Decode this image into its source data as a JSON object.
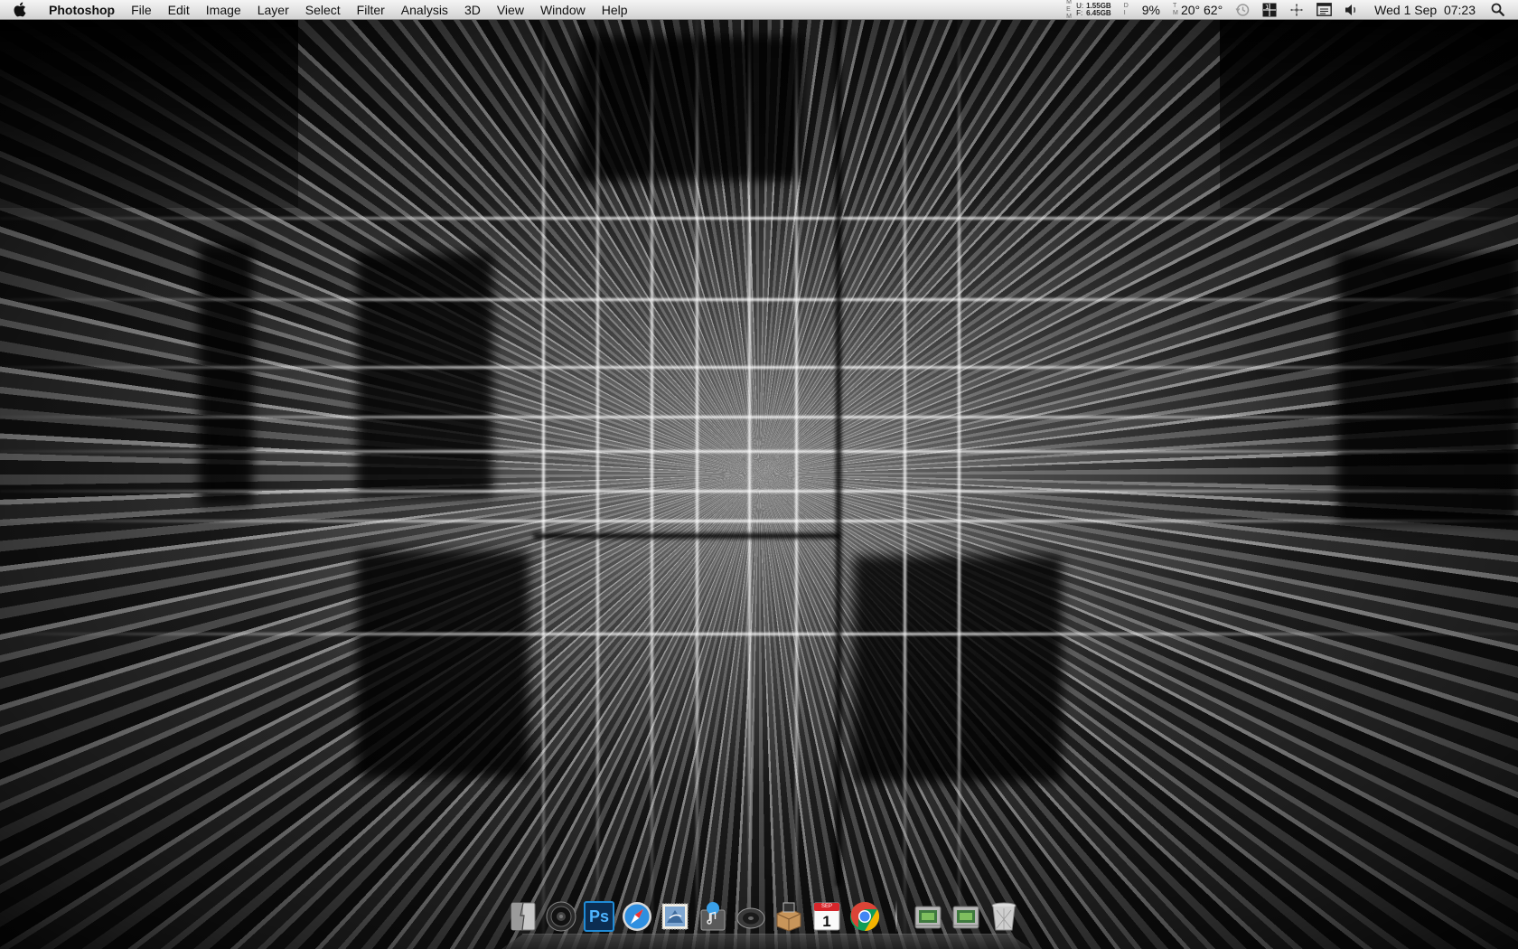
{
  "menubar": {
    "app_name": "Photoshop",
    "menus": [
      "File",
      "Edit",
      "Image",
      "Layer",
      "Select",
      "Filter",
      "Analysis",
      "3D",
      "View",
      "Window",
      "Help"
    ],
    "memory": {
      "used_label": "U:",
      "free_label": "F:",
      "used_value": "1.55GB",
      "free_value": "6.45GB"
    },
    "cpu_percent": "9%",
    "temperatures": "20° 62°",
    "clock": "Wed 1 Sep  07:23"
  },
  "dock": {
    "apps": [
      {
        "name": "Finder",
        "icon": "finder-icon"
      },
      {
        "name": "Speaker",
        "icon": "speaker-icon"
      },
      {
        "name": "Photoshop",
        "icon": "photoshop-icon",
        "label": "Ps"
      },
      {
        "name": "Safari",
        "icon": "safari-compass-icon"
      },
      {
        "name": "Mail",
        "icon": "mail-stamp-icon"
      },
      {
        "name": "iTunes",
        "icon": "itunes-icon"
      },
      {
        "name": "Audio",
        "icon": "audio-speaker-icon"
      },
      {
        "name": "Installer",
        "icon": "installer-box-icon"
      },
      {
        "name": "iCal",
        "icon": "calendar-icon",
        "day": "1",
        "month": "SEP"
      },
      {
        "name": "Chrome",
        "icon": "chrome-icon"
      }
    ],
    "stacks": [
      {
        "name": "Downloads",
        "icon": "hard-drive-icon"
      },
      {
        "name": "Documents",
        "icon": "hard-drive-icon"
      },
      {
        "name": "Trash",
        "icon": "trash-icon"
      }
    ]
  },
  "colors": {
    "ps_blue": "#1f8bd6",
    "ps_dark": "#0b2d52",
    "chrome_red": "#db4437",
    "chrome_yellow": "#f4b400",
    "chrome_green": "#0f9d58",
    "chrome_blue": "#4285f4"
  }
}
